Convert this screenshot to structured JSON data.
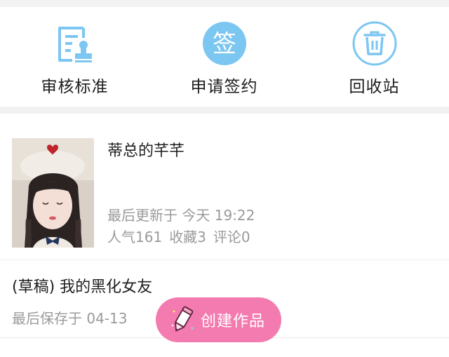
{
  "quick_actions": {
    "review": {
      "label": "审核标准",
      "icon": "document-stamp-icon"
    },
    "sign": {
      "label": "申请签约",
      "icon": "sign-badge-icon",
      "badge_text": "签"
    },
    "recycle": {
      "label": "回收站",
      "icon": "trash-icon"
    }
  },
  "work": {
    "title": "蒂总的芊芊",
    "updated": "最后更新于 今天 19:22",
    "popularity": "人气161",
    "favorites": "收藏3",
    "comments": "评论0"
  },
  "draft": {
    "title": "(草稿) 我的黑化女友",
    "saved": "最后保存于 04-13"
  },
  "fab": {
    "label": "创建作品",
    "icon": "pencil-icon"
  },
  "colors": {
    "accent_blue": "#7cc6f2",
    "fab_pink": "#f47bb0"
  }
}
